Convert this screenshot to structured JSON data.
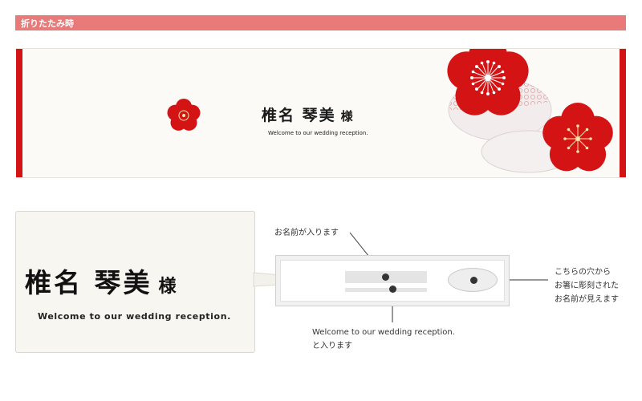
{
  "section_title": "折りたたみ時",
  "card": {
    "name": "椎名 琴美",
    "honorific": "様",
    "welcome": "Welcome to our wedding reception."
  },
  "zoom": {
    "name": "椎名 琴美",
    "honorific": "様",
    "welcome": "Welcome to our wedding reception."
  },
  "callouts": {
    "name_area": "お名前が入ります",
    "welcome_line1": "Welcome to our wedding reception.",
    "welcome_line2": "と入ります",
    "window_line1": "こちらの穴から",
    "window_line2": "お箸に彫刻された",
    "window_line3": "お名前が見えます"
  },
  "colors": {
    "header_bar": "#e97a7a",
    "plum_red": "#d41414",
    "paper": "#fbfaf6"
  }
}
